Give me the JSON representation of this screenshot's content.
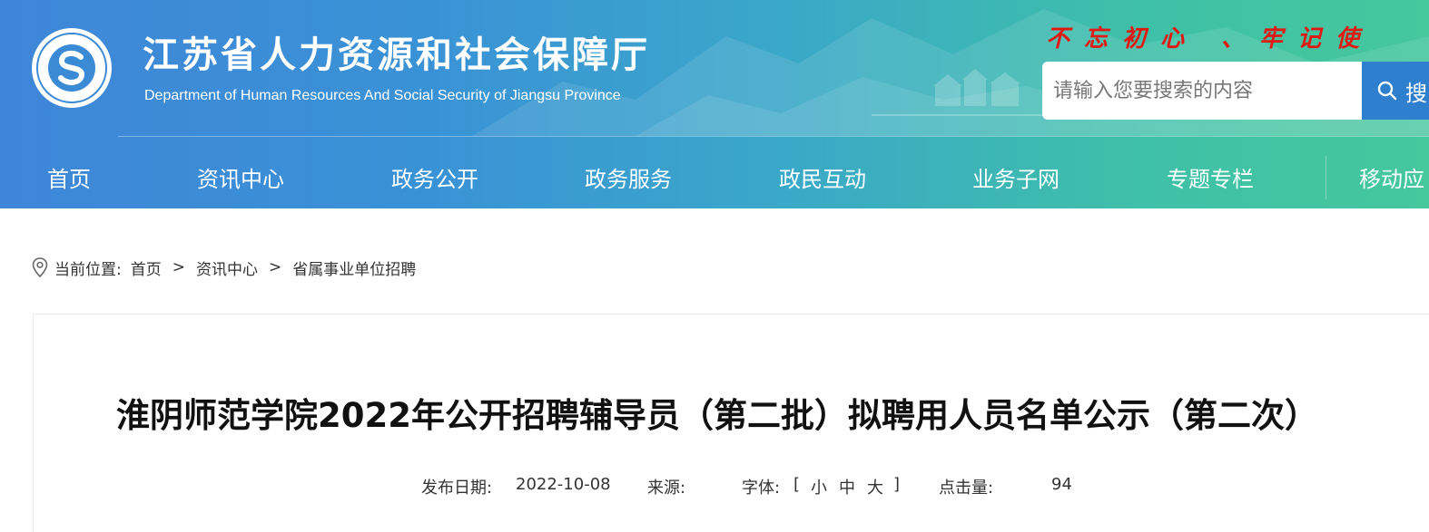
{
  "header": {
    "title": "江苏省人力资源和社会保障厅",
    "subtitle": "Department of Human Resources And Social Security of Jiangsu Province",
    "logo_ring_text": "江苏省人力资源和社会保障厅",
    "slogan": "不忘初心 、牢记使",
    "search": {
      "placeholder": "请输入您要搜索的内容",
      "button_label": "搜"
    }
  },
  "nav": {
    "items": [
      "首页",
      "资讯中心",
      "政务公开",
      "政务服务",
      "政民互动",
      "业务子网",
      "专题专栏",
      "移动应"
    ]
  },
  "breadcrumb": {
    "label": "当前位置:",
    "items": [
      "首页",
      "资讯中心",
      "省属事业单位招聘"
    ],
    "separator": ">"
  },
  "article": {
    "title": "淮阴师范学院2022年公开招聘辅导员（第二批）拟聘用人员名单公示（第二次）",
    "meta": {
      "date_label": "发布日期:",
      "date_value": "2022-10-08",
      "source_label": "来源:",
      "source_value": "",
      "font_label": "字体:",
      "font_open": "[",
      "font_small": "小",
      "font_medium": "中",
      "font_large": "大",
      "font_close": "]",
      "clicks_label": "点击量:",
      "clicks_value": "94"
    }
  },
  "colors": {
    "header_start": "#3f86d8",
    "header_end": "#46c79c",
    "slogan": "#e01a12",
    "search_button": "#2f7fcf"
  },
  "icons": {
    "search": "search-icon",
    "location": "location-pin-icon",
    "logo": "department-logo-icon"
  }
}
